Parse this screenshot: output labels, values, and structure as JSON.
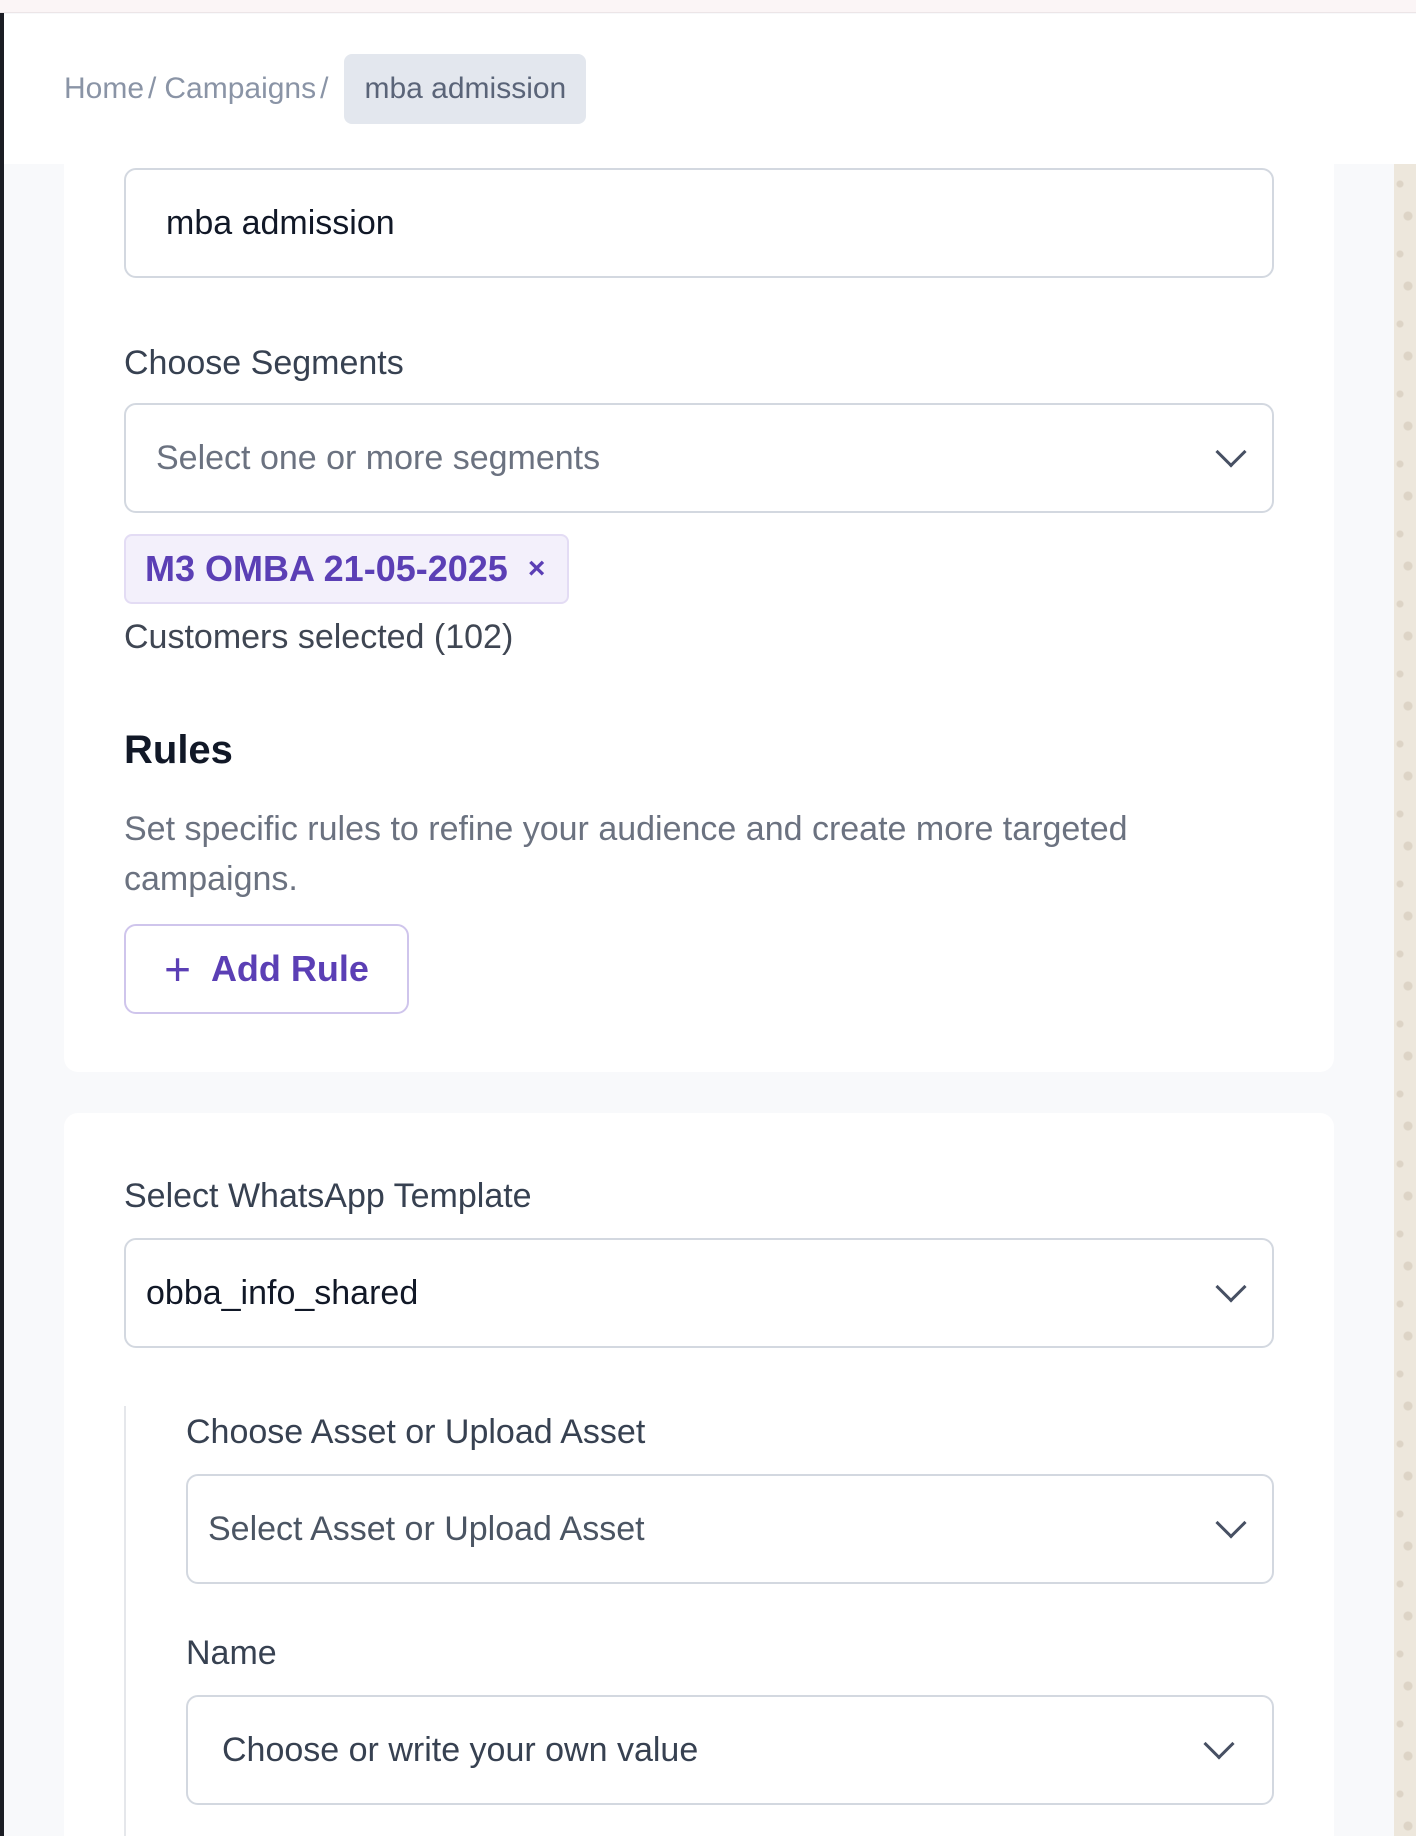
{
  "breadcrumb": {
    "home": "Home",
    "campaigns": "Campaigns",
    "separator": "/",
    "current": "mba admission"
  },
  "campaign": {
    "name_value": "mba admission"
  },
  "segments": {
    "label": "Choose Segments",
    "placeholder": "Select one or more segments",
    "selected": [
      "M3 OMBA 21-05-2025"
    ],
    "remove_glyph": "×",
    "count_text": "Customers selected (102)"
  },
  "rules": {
    "heading": "Rules",
    "description": "Set specific rules to refine your audience and create more targeted campaigns.",
    "add_button": "Add Rule",
    "add_icon": "+"
  },
  "template": {
    "label": "Select WhatsApp Template",
    "value": "obba_info_shared"
  },
  "asset": {
    "label": "Choose Asset or Upload Asset",
    "placeholder": "Select Asset or Upload Asset"
  },
  "name_field": {
    "label": "Name",
    "placeholder": "Choose or write your own value"
  },
  "colors": {
    "accent": "#5b3fb5",
    "chip_bg": "#f3f0fb",
    "breadcrumb_current_bg": "#e3e7ee"
  }
}
